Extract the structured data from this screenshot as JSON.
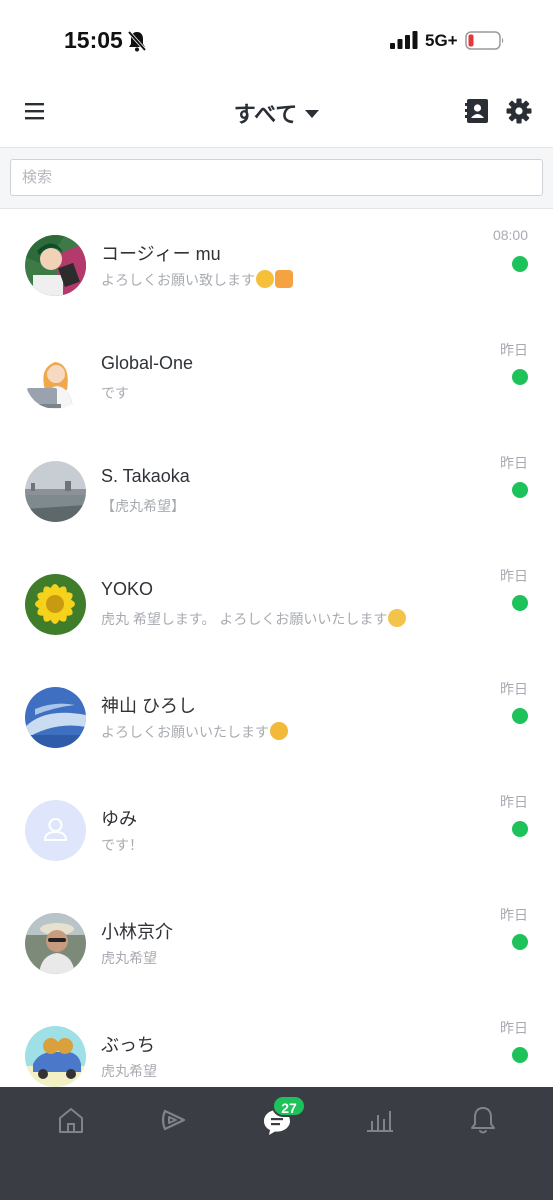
{
  "status_bar": {
    "time": "15:05",
    "network": "5G+",
    "battery_color": "#e5383b"
  },
  "header": {
    "title": "すべて",
    "menu_icon": "hamburger-icon",
    "contacts_icon": "contacts-icon",
    "settings_icon": "gear-icon"
  },
  "search": {
    "placeholder": "検索",
    "value": ""
  },
  "accent_color": "#1dc25b",
  "chats": [
    {
      "name": "コージィー mu",
      "message": "よろしくお願い致します",
      "time": "08:00",
      "unread": true,
      "avatar": "anime-illustration"
    },
    {
      "name": "Global-One",
      "message": "です",
      "time": "昨日",
      "unread": true,
      "avatar": "woman-with-laptop"
    },
    {
      "name": "S. Takaoka",
      "message": "【虎丸希望】",
      "time": "昨日",
      "unread": true,
      "avatar": "harbor-photo"
    },
    {
      "name": "YOKO",
      "message": "虎丸 希望します。 よろしくお願いいたします",
      "time": "昨日",
      "unread": true,
      "avatar": "sunflower"
    },
    {
      "name": "神山 ひろし",
      "message": "よろしくお願いいたします",
      "time": "昨日",
      "unread": true,
      "avatar": "blue-sky"
    },
    {
      "name": "ゆみ",
      "message": "です！",
      "time": "昨日",
      "unread": true,
      "avatar": "default-person"
    },
    {
      "name": "小林京介",
      "message": "虎丸希望",
      "time": "昨日",
      "unread": true,
      "avatar": "man-with-hat"
    },
    {
      "name": "ぶっち",
      "message": "虎丸希望",
      "time": "昨日",
      "unread": true,
      "avatar": "cartoon-car"
    }
  ],
  "bottom_nav": {
    "badge_count": "27",
    "items": [
      "home-icon",
      "play-icon",
      "chat-icon",
      "chart-icon",
      "bell-icon"
    ],
    "active": "chat-icon"
  }
}
